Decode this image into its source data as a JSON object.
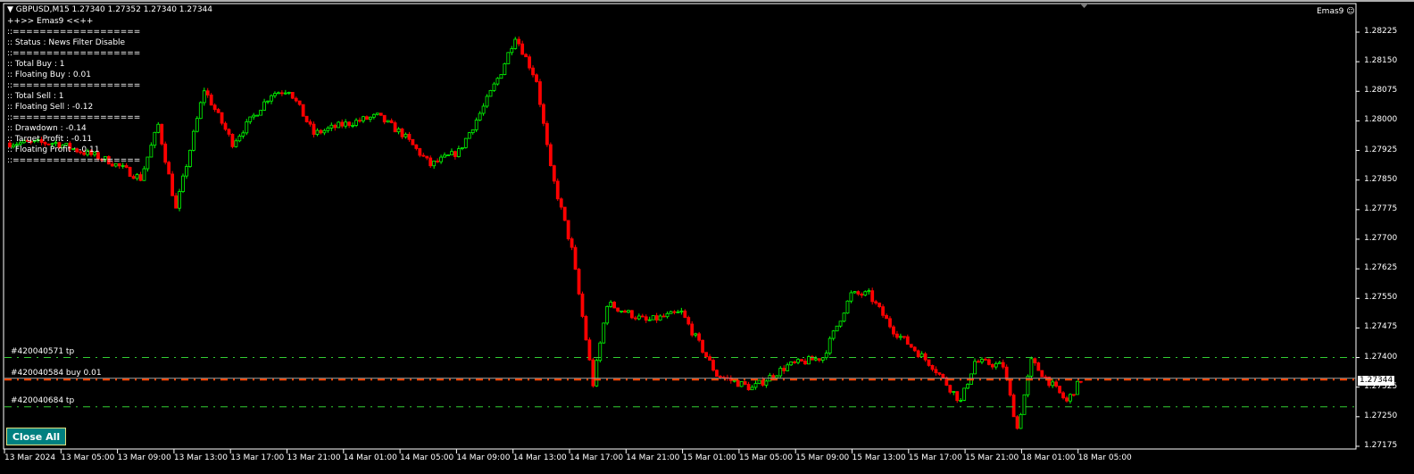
{
  "header": {
    "symbol_line": "GBPUSD,M15  1.27340 1.27352 1.27340 1.27344",
    "indicator_name": "Emas9"
  },
  "info_panel": [
    "++>> Emas9 <<++",
    "::===================",
    ":: Status : News Filter Disable",
    "::===================",
    ":: Total Buy : 1",
    ":: Floating Buy : 0.01",
    "::===================",
    ":: Total Sell : 1",
    ":: Floating Sell : -0.12",
    "::===================",
    ":: Drawdown : -0.14",
    ":: Target Profit : -0.11",
    ":: Floating Profit : -0.11",
    "::==================="
  ],
  "order_lines": [
    {
      "label": "#420040571 tp",
      "price": 1.274,
      "color": "#32cd32",
      "style": "dashdot"
    },
    {
      "label": "#420040584 buy 0.01",
      "price": 1.27344,
      "color": "#ff4500",
      "style": "dashdot"
    },
    {
      "label": "#420040684 tp",
      "price": 1.27275,
      "color": "#32cd32",
      "style": "dashdot"
    }
  ],
  "buttons": {
    "close_all": "Close All"
  },
  "current_price": "1.27344",
  "price_axis": [
    "1.28225",
    "1.28150",
    "1.28075",
    "1.28000",
    "1.27925",
    "1.27850",
    "1.27775",
    "1.27700",
    "1.27625",
    "1.27550",
    "1.27475",
    "1.27400",
    "1.27325",
    "1.27250",
    "1.27175"
  ],
  "time_axis": [
    "13 Mar 2024",
    "13 Mar 05:00",
    "13 Mar 09:00",
    "13 Mar 13:00",
    "13 Mar 17:00",
    "13 Mar 21:00",
    "14 Mar 01:00",
    "14 Mar 05:00",
    "14 Mar 09:00",
    "14 Mar 13:00",
    "14 Mar 17:00",
    "14 Mar 21:00",
    "15 Mar 01:00",
    "15 Mar 05:00",
    "15 Mar 09:00",
    "15 Mar 13:00",
    "15 Mar 17:00",
    "15 Mar 21:00",
    "18 Mar 01:00",
    "18 Mar 05:00"
  ],
  "colors": {
    "bull": "#00ff00",
    "bear": "#ff0000",
    "background": "#000000",
    "button": "#008080"
  },
  "price_path": [
    [
      0,
      1.27944
    ],
    [
      14,
      1.27944
    ],
    [
      29,
      1.27899
    ],
    [
      38,
      1.27854
    ],
    [
      43,
      1.2799
    ],
    [
      48,
      1.27775
    ],
    [
      56,
      1.2808
    ],
    [
      64,
      1.27944
    ],
    [
      75,
      1.28069
    ],
    [
      80,
      1.2808
    ],
    [
      87,
      1.27967
    ],
    [
      95,
      1.2799
    ],
    [
      105,
      1.28012
    ],
    [
      112,
      1.27967
    ],
    [
      120,
      1.27888
    ],
    [
      128,
      1.27922
    ],
    [
      135,
      1.28035
    ],
    [
      140,
      1.28125
    ],
    [
      144,
      1.28216
    ],
    [
      150,
      1.28103
    ],
    [
      154,
      1.27877
    ],
    [
      160,
      1.27673
    ],
    [
      164,
      1.27447
    ],
    [
      166,
      1.27333
    ],
    [
      170,
      1.27537
    ],
    [
      181,
      1.27492
    ],
    [
      191,
      1.27514
    ],
    [
      201,
      1.27356
    ],
    [
      211,
      1.27322
    ],
    [
      221,
      1.27379
    ],
    [
      231,
      1.27401
    ],
    [
      239,
      1.2756
    ],
    [
      244,
      1.2756
    ],
    [
      251,
      1.27469
    ],
    [
      262,
      1.27379
    ],
    [
      270,
      1.27288
    ],
    [
      274,
      1.2739
    ],
    [
      282,
      1.27379
    ],
    [
      286,
      1.2722
    ],
    [
      290,
      1.2739
    ],
    [
      300,
      1.27288
    ],
    [
      304,
      1.27344
    ]
  ]
}
